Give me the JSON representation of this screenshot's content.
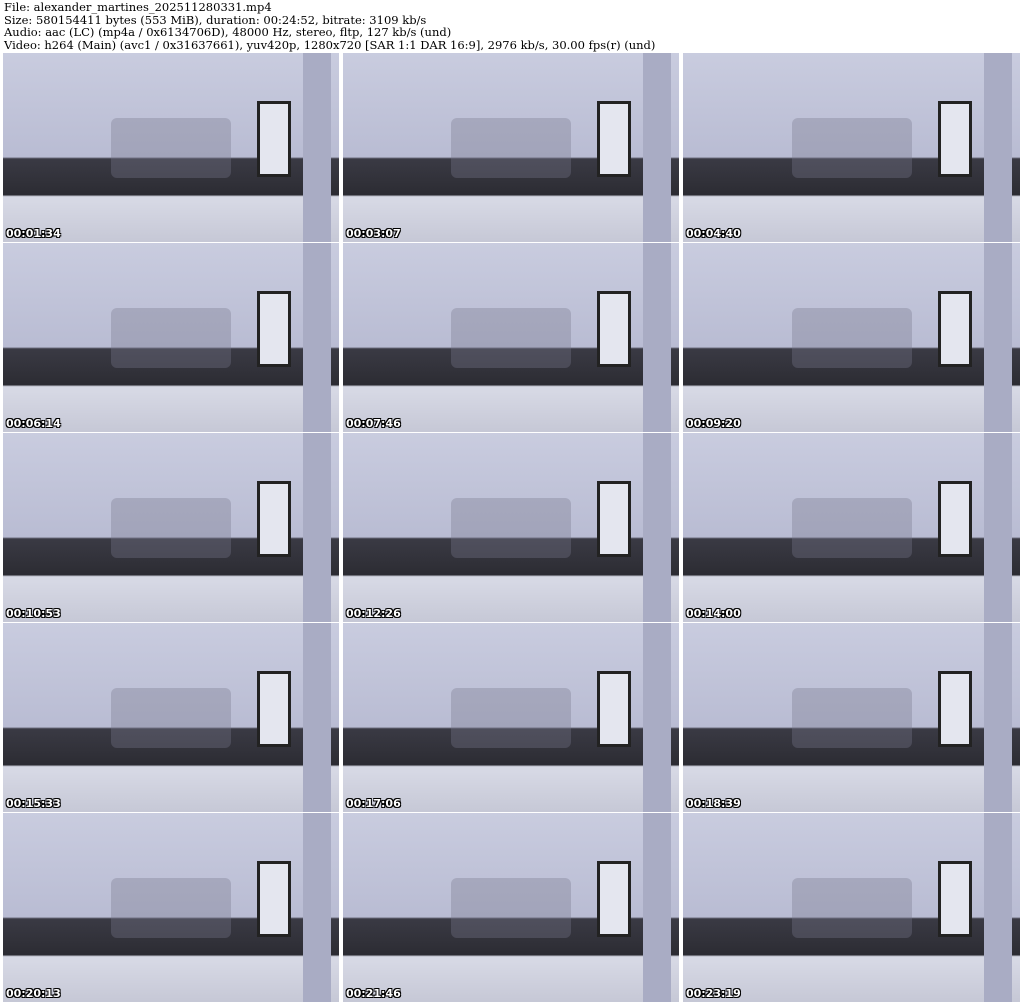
{
  "header": {
    "file": "File: alexander_martines_202511280331.mp4",
    "size": "Size: 580154411 bytes (553 MiB), duration: 00:24:52, bitrate: 3109 kb/s",
    "audio": "Audio: aac (LC) (mp4a / 0x6134706D), 48000 Hz, stereo, fltp, 127 kb/s (und)",
    "video": "Video: h264 (Main) (avc1 / 0x31637661), yuv420p, 1280x720 [SAR 1:1 DAR 16:9], 2976 kb/s, 30.00 fps(r) (und)"
  },
  "thumbnails": [
    {
      "timestamp": "00:01:34"
    },
    {
      "timestamp": "00:03:07"
    },
    {
      "timestamp": "00:04:40"
    },
    {
      "timestamp": "00:06:14"
    },
    {
      "timestamp": "00:07:46"
    },
    {
      "timestamp": "00:09:20"
    },
    {
      "timestamp": "00:10:53"
    },
    {
      "timestamp": "00:12:26"
    },
    {
      "timestamp": "00:14:00"
    },
    {
      "timestamp": "00:15:33"
    },
    {
      "timestamp": "00:17:06"
    },
    {
      "timestamp": "00:18:39"
    },
    {
      "timestamp": "00:20:13"
    },
    {
      "timestamp": "00:21:46"
    },
    {
      "timestamp": "00:23:19"
    }
  ]
}
